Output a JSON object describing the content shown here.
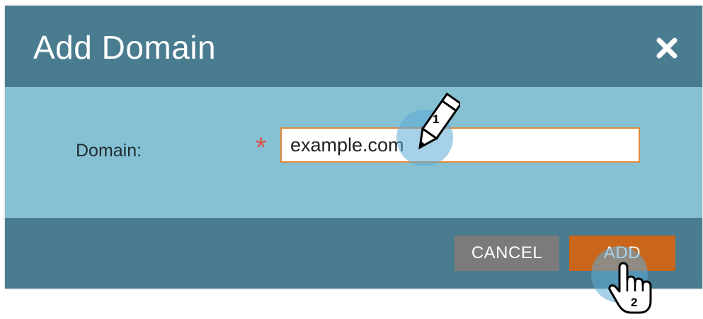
{
  "dialog": {
    "title": "Add Domain",
    "close_icon": "close-icon"
  },
  "form": {
    "domain_label": "Domain:",
    "required_mark": "*",
    "domain_value": "example.com"
  },
  "footer": {
    "cancel_label": "CANCEL",
    "add_label": "ADD"
  },
  "annotations": {
    "step_1": "1",
    "step_2": "2",
    "step_1_icon": "pencil-cursor-icon",
    "step_2_icon": "hand-pointer-icon"
  },
  "colors": {
    "header": "#4a7c8f",
    "body": "#86c1d3",
    "add_button": "#c9661c",
    "cancel_button": "#7b7b7b",
    "input_border": "#e08a3a",
    "required": "#d9534f"
  }
}
